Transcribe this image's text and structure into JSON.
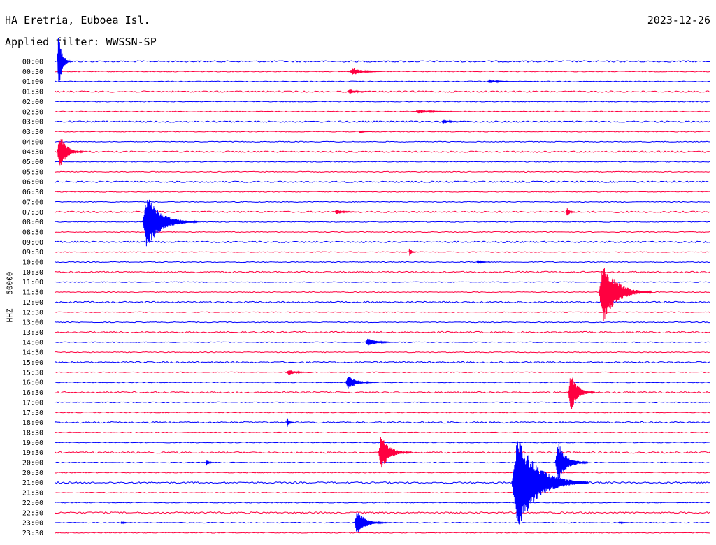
{
  "header": {
    "station": "HA Eretria, Euboea Isl.",
    "date": "2023-12-26",
    "filter": "Applied filter: WWSSN-SP"
  },
  "chart_data": {
    "type": "line",
    "title": "HA Eretria, Euboea Isl.",
    "subtitle": "Applied filter: WWSSN-SP",
    "ylabel": "HHZ - 50000",
    "row_labels": [
      "00:00",
      "00:30",
      "01:00",
      "01:30",
      "02:00",
      "02:30",
      "03:00",
      "03:30",
      "04:00",
      "04:30",
      "05:00",
      "05:30",
      "06:00",
      "06:30",
      "07:00",
      "07:30",
      "08:00",
      "08:30",
      "09:00",
      "09:30",
      "10:00",
      "10:30",
      "11:00",
      "11:30",
      "12:00",
      "12:30",
      "13:00",
      "13:30",
      "14:00",
      "14:30",
      "15:00",
      "15:30",
      "16:00",
      "16:30",
      "17:00",
      "17:30",
      "18:00",
      "18:30",
      "19:00",
      "19:30",
      "20:00",
      "20:30",
      "21:00",
      "21:30",
      "22:00",
      "22:30",
      "23:00",
      "23:30"
    ],
    "colors": {
      "even": "#0000ff",
      "odd": "#ff0040",
      "bold_even": "#0000cc"
    },
    "trace_minutes": 30,
    "events": [
      {
        "row": 0,
        "minute": 0.1,
        "amplitude": 45,
        "duration": 0.6
      },
      {
        "row": 1,
        "minute": 13.5,
        "amplitude": 6,
        "duration": 1.5
      },
      {
        "row": 2,
        "minute": 19.8,
        "amplitude": 3,
        "duration": 1.2
      },
      {
        "row": 3,
        "minute": 13.4,
        "amplitude": 4,
        "duration": 1.0
      },
      {
        "row": 5,
        "minute": 16.5,
        "amplitude": 3,
        "duration": 2.0
      },
      {
        "row": 6,
        "minute": 17.7,
        "amplitude": 3,
        "duration": 1.0
      },
      {
        "row": 7,
        "minute": 13.9,
        "amplitude": 2,
        "duration": 0.6
      },
      {
        "row": 9,
        "minute": 0.1,
        "amplitude": 28,
        "duration": 1.2
      },
      {
        "row": 15,
        "minute": 12.8,
        "amplitude": 4,
        "duration": 1.0
      },
      {
        "row": 15,
        "minute": 23.4,
        "amplitude": 8,
        "duration": 0.4
      },
      {
        "row": 16,
        "minute": 4.0,
        "amplitude": 40,
        "duration": 2.5
      },
      {
        "row": 19,
        "minute": 16.2,
        "amplitude": 8,
        "duration": 0.3
      },
      {
        "row": 20,
        "minute": 19.3,
        "amplitude": 3,
        "duration": 0.6
      },
      {
        "row": 23,
        "minute": 24.9,
        "amplitude": 45,
        "duration": 2.4
      },
      {
        "row": 28,
        "minute": 14.2,
        "amplitude": 6,
        "duration": 1.5
      },
      {
        "row": 31,
        "minute": 10.6,
        "amplitude": 4,
        "duration": 1.2
      },
      {
        "row": 32,
        "minute": 13.3,
        "amplitude": 10,
        "duration": 1.5
      },
      {
        "row": 33,
        "minute": 23.5,
        "amplitude": 30,
        "duration": 1.2
      },
      {
        "row": 36,
        "minute": 10.6,
        "amplitude": 8,
        "duration": 0.3
      },
      {
        "row": 39,
        "minute": 14.8,
        "amplitude": 26,
        "duration": 1.5
      },
      {
        "row": 40,
        "minute": 6.9,
        "amplitude": 5,
        "duration": 0.4
      },
      {
        "row": 40,
        "minute": 22.9,
        "amplitude": 30,
        "duration": 1.5
      },
      {
        "row": 42,
        "minute": 20.9,
        "amplitude": 70,
        "duration": 3.5
      },
      {
        "row": 46,
        "minute": 13.7,
        "amplitude": 18,
        "duration": 1.5
      },
      {
        "row": 46,
        "minute": 3.0,
        "amplitude": 2,
        "duration": 0.5
      },
      {
        "row": 46,
        "minute": 25.8,
        "amplitude": 2,
        "duration": 0.5
      }
    ]
  }
}
